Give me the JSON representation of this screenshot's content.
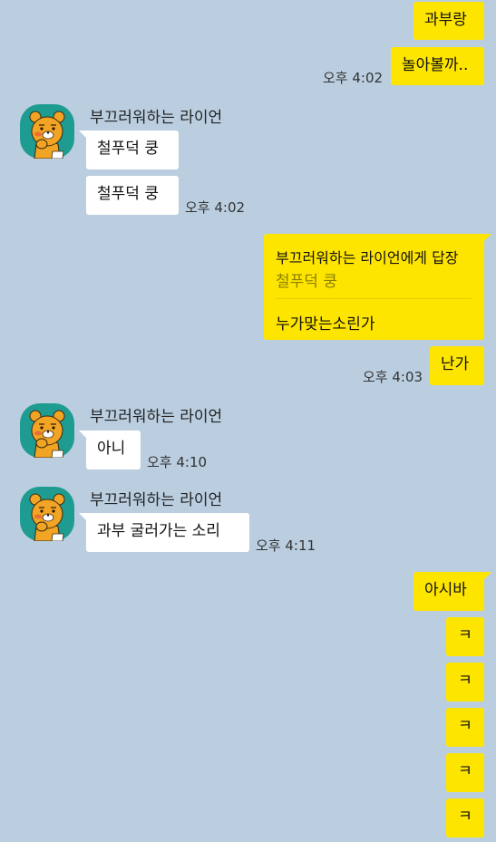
{
  "colors": {
    "background": "#bacee0",
    "my_bubble": "#fee500",
    "their_bubble": "#ffffff",
    "avatar_bg": "#1f9c91",
    "lion_face": "#f2a425"
  },
  "messages": {
    "m1": {
      "text": "과부랑"
    },
    "m2": {
      "text": "놀아볼까..",
      "time": "오후 4:02"
    },
    "g1": {
      "sender": "부끄러워하는 라이언",
      "avatar_icon": "ryan-lion-avatar-icon",
      "b1": "철푸덕 쿵",
      "b2": "철푸덕 쿵",
      "time": "오후 4:02"
    },
    "reply": {
      "title": "부끄러워하는 라이언에게 답장",
      "quote": "철푸덕 쿵",
      "text": "누가맞는소린가"
    },
    "m3": {
      "text": "난가",
      "time": "오후 4:03"
    },
    "g2": {
      "sender": "부끄러워하는 라이언",
      "avatar_icon": "ryan-lion-avatar-icon",
      "b1": "아니",
      "time": "오후 4:10"
    },
    "g3": {
      "sender": "부끄러워하는 라이언",
      "avatar_icon": "ryan-lion-avatar-icon",
      "b1": "과부 굴러가는 소리",
      "time": "오후 4:11"
    },
    "m4": {
      "text": "아시바"
    },
    "k": [
      "ㅋ",
      "ㅋ",
      "ㅋ",
      "ㅋ",
      "ㅋ"
    ]
  }
}
